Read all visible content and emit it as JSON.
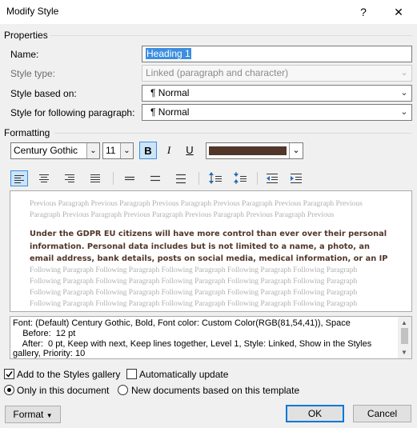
{
  "window": {
    "title": "Modify Style",
    "help_label": "?",
    "close_label": "✕"
  },
  "properties": {
    "group_label": "Properties",
    "name_label": "Name:",
    "name_value": "Heading 1",
    "style_type_label": "Style type:",
    "style_type_value": "Linked (paragraph and character)",
    "based_on_label": "Style based on:",
    "based_on_value": "¶  Normal",
    "following_label": "Style for following paragraph:",
    "following_value": "¶  Normal"
  },
  "formatting": {
    "group_label": "Formatting",
    "font_name": "Century Gothic",
    "font_size": "11",
    "bold_label": "B",
    "italic_label": "I",
    "underline_label": "U",
    "font_color": "#51362a"
  },
  "preview": {
    "previous_text": "Previous Paragraph Previous Paragraph Previous Paragraph Previous Paragraph Previous Paragraph Previous Paragraph Previous Paragraph Previous Paragraph Previous Paragraph Previous Paragraph Previous Paragraph",
    "sample_text": "Under the GDPR EU citizens will have more control than ever over their personal information. Personal data includes but is not limited to a name, a photo, an email address, bank details, posts on social media, medical information, or an IP address. Anythi",
    "following_text": "Following Paragraph Following Paragraph Following Paragraph Following Paragraph Following Paragraph Following Paragraph Following Paragraph Following Paragraph Following Paragraph Following Paragraph Following Paragraph Following Paragraph Following Paragraph Following Paragraph Following Paragraph Following Paragraph Following Paragraph Following Paragraph Following Paragraph Following Paragraph Following Paragraph Following Paragraph Following Paragraph Following Paragraph Following Paragraph"
  },
  "description": {
    "line1": "Font: (Default) Century Gothic, Bold, Font color: Custom Color(RGB(81,54,41)), Space",
    "line2": "    Before:  12 pt",
    "line3": "    After:  0 pt, Keep with next, Keep lines together, Level 1, Style: Linked, Show in the Styles",
    "line4": "gallery, Priority: 10"
  },
  "options": {
    "add_to_gallery_label": "Add to the Styles gallery",
    "add_to_gallery_checked": true,
    "auto_update_label": "Automatically update",
    "auto_update_checked": false,
    "only_this_doc_label": "Only in this document",
    "new_docs_label": "New documents based on this template",
    "selected_scope": "only_this_doc"
  },
  "buttons": {
    "format_label": "Format",
    "ok_label": "OK",
    "cancel_label": "Cancel"
  },
  "colors": {
    "accent": "#0078d7",
    "selection": "#cce4f7",
    "selection_border": "#3d8ee0",
    "font_color_swatch": "#51362a"
  }
}
